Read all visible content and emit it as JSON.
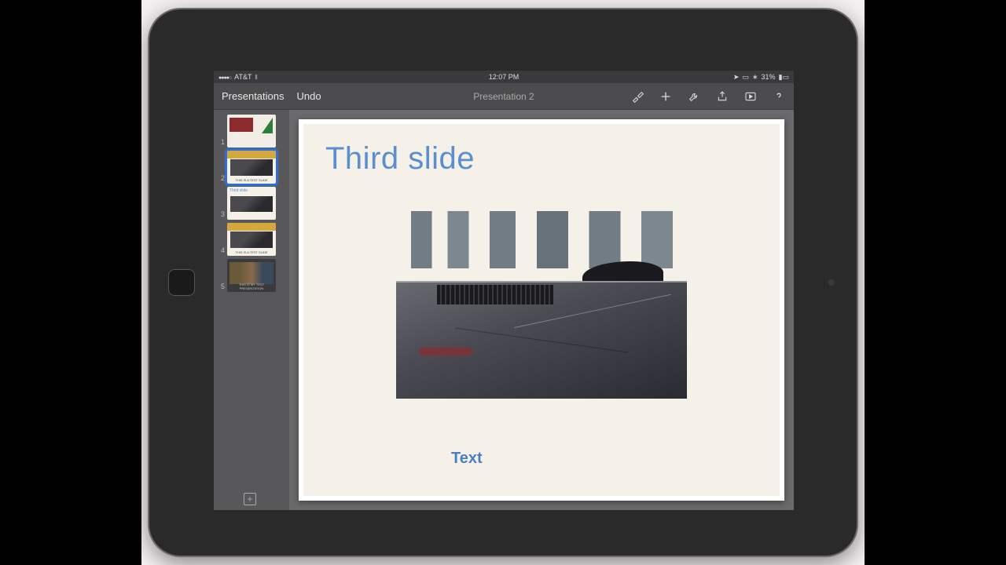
{
  "status": {
    "carrier": "AT&T",
    "time": "12:07 PM",
    "battery_text": "31%"
  },
  "toolbar": {
    "back_label": "Presentations",
    "undo_label": "Undo",
    "title": "Presentation 2"
  },
  "thumbs": {
    "n1": "1",
    "n2": "2",
    "n3": "3",
    "n4": "4",
    "n5": "5",
    "selected_index": 2
  },
  "slide": {
    "title": "Third slide",
    "caption": "Text"
  }
}
